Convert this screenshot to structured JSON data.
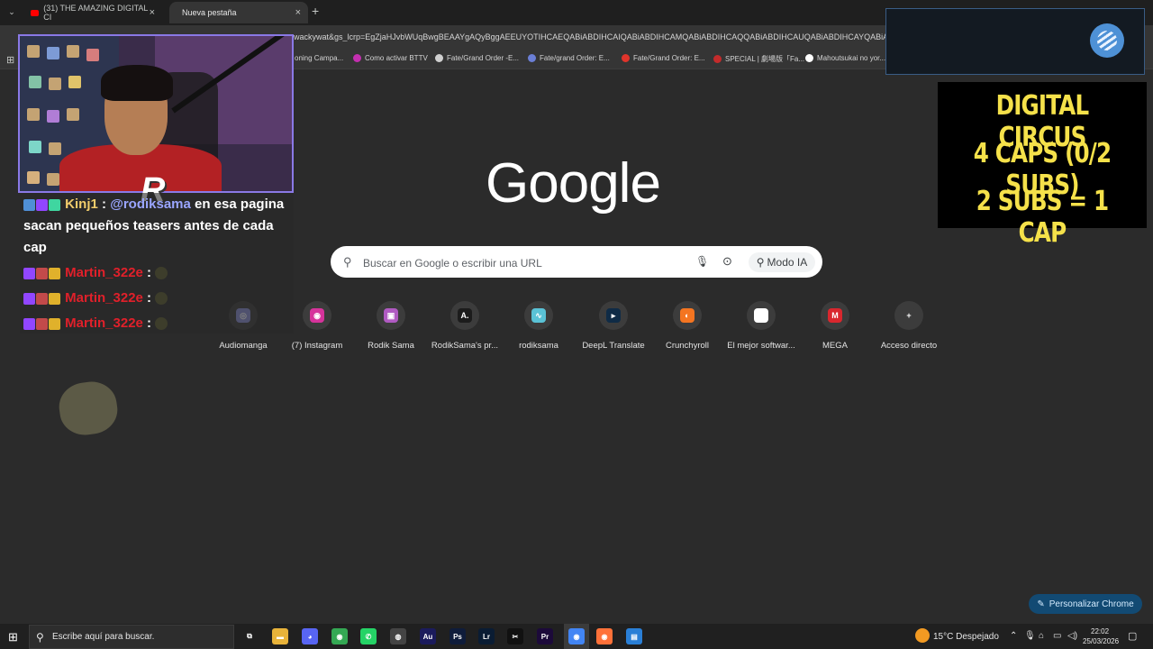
{
  "browser": {
    "tabs": [
      {
        "label": "(31) THE AMAZING DIGITAL CI",
        "close": "×"
      },
      {
        "label": "Nueva pestaña",
        "close": "×"
      }
    ],
    "new_tab": "+",
    "url": "wackywat&gs_lcrp=EgZjaHJvbWUqBwgBEAAYgAQyBggAEEUYOTIHCAEQABiABDIHCAIQABiABDIHCAMQABiABDIHCAQQABiABDIHCAUQABiABDIHCAYQABiABDIHCAcQABiABDIHCAgQABiABDIHCAkQABiABNIBCDI",
    "bookmarks": [
      {
        "label": "oning Campa...",
        "color": "#555555"
      },
      {
        "label": "Como activar BTTV",
        "color": "#c42fb0"
      },
      {
        "label": "Fate/Grand Order -E...",
        "color": "#d0d0d0"
      },
      {
        "label": "Fate/grand Order: E...",
        "color": "#6b7fd6"
      },
      {
        "label": "Fate/Grand Order: E...",
        "color": "#e0342b"
      },
      {
        "label": "SPECIAL | 劇場版「Fa...",
        "color": "#c42b2b"
      },
      {
        "label": "Mahoutsukai no yor...",
        "color": "#ffffff"
      }
    ]
  },
  "google": {
    "logo": "Google",
    "search_placeholder": "Buscar en Google o escribir una URL",
    "ai_mode": "Modo IA",
    "shortcuts": [
      {
        "label": "Audiomanga",
        "glyph": "◎",
        "color": "#8a8fd6"
      },
      {
        "label": "(7) Instagram",
        "glyph": "◉",
        "color": "#d6339b"
      },
      {
        "label": "Rodik Sama",
        "glyph": "▣",
        "color": "#b05ac2"
      },
      {
        "label": "RodikSama's pr...",
        "glyph": "A.",
        "color": "#1c1c1c"
      },
      {
        "label": "rodiksama",
        "glyph": "∿",
        "color": "#5ac2d6"
      },
      {
        "label": "DeepL Translate",
        "glyph": "▸",
        "color": "#0f2b46"
      },
      {
        "label": "Crunchyroll",
        "glyph": "◐",
        "color": "#f47521"
      },
      {
        "label": "El mejor softwar...",
        "glyph": "◆",
        "color": "#ffffff"
      },
      {
        "label": "MEGA",
        "glyph": "M",
        "color": "#d9272e"
      },
      {
        "label": "Acceso directo",
        "glyph": "+",
        "color": "#3c3c3c"
      }
    ],
    "customize": "Personalizar Chrome"
  },
  "chat": {
    "messages": [
      {
        "user": "Kinj1",
        "sep": " : ",
        "mention": "@rodiksama",
        "text": " en esa pagina sacan pequeños teasers antes de cada cap"
      },
      {
        "user": "Martin_322e",
        "sep": " : "
      },
      {
        "user": "Martin_322e",
        "sep": " : "
      },
      {
        "user": "Martin_322e",
        "sep": " : "
      }
    ]
  },
  "goal": {
    "line1": "DIGITAL CIRCUS",
    "line2": "4 CAPS (0/2 SUBS)",
    "line3": "2 SUBS = 1 CAP"
  },
  "taskbar": {
    "search": "Escribe aquí para buscar.",
    "apps": [
      {
        "name": "task-view",
        "glyph": "⧉",
        "color": "#202020"
      },
      {
        "name": "file-explorer",
        "glyph": "▬",
        "color": "#e8b33a"
      },
      {
        "name": "discord",
        "glyph": "◕",
        "color": "#5865f2"
      },
      {
        "name": "chrome",
        "glyph": "◉",
        "color": "#34a853"
      },
      {
        "name": "whatsapp",
        "glyph": "✆",
        "color": "#25d366"
      },
      {
        "name": "obs",
        "glyph": "◍",
        "color": "#444444"
      },
      {
        "name": "audition",
        "glyph": "Au",
        "color": "#1b1b5c"
      },
      {
        "name": "photoshop",
        "glyph": "Ps",
        "color": "#0f1c3a"
      },
      {
        "name": "lightroom",
        "glyph": "Lr",
        "color": "#0a1c33"
      },
      {
        "name": "capcut",
        "glyph": "✂",
        "color": "#111111"
      },
      {
        "name": "premiere",
        "glyph": "Pr",
        "color": "#1c0a3a"
      },
      {
        "name": "chrome-active",
        "glyph": "◉",
        "color": "#4285f4"
      },
      {
        "name": "firefox",
        "glyph": "◉",
        "color": "#ff7139"
      },
      {
        "name": "window-app",
        "glyph": "▤",
        "color": "#2a7fd6"
      }
    ],
    "weather": "15°C  Despejado",
    "time": "22:02",
    "date": "25/03/2026"
  }
}
